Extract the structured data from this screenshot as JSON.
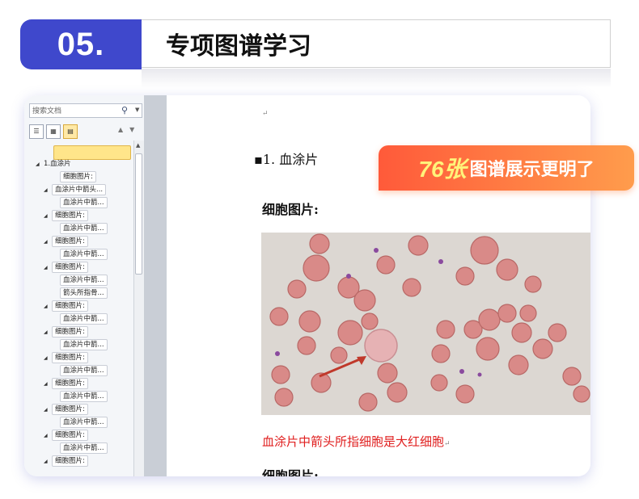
{
  "header": {
    "number": "05.",
    "title": "专项图谱学习"
  },
  "nav": {
    "search_placeholder": "搜索文档",
    "search_icon": "magnifier-icon",
    "tabs": [
      "headings-view",
      "pages-view",
      "results-view"
    ],
    "tree": [
      {
        "label": "",
        "level": 1,
        "selected": true
      },
      {
        "label": "1.血涂片",
        "level": 0,
        "expanded": true
      },
      {
        "label": "细胞图片:",
        "level": 2
      },
      {
        "label": "血涂片中箭头...",
        "level": 1,
        "expanded": true
      },
      {
        "label": "血涂片中箭...",
        "level": 2
      },
      {
        "label": "细胞图片:",
        "level": 1,
        "expanded": true
      },
      {
        "label": "血涂片中箭...",
        "level": 2
      },
      {
        "label": "细胞图片:",
        "level": 1,
        "expanded": true
      },
      {
        "label": "血涂片中箭...",
        "level": 2
      },
      {
        "label": "细胞图片:",
        "level": 1,
        "expanded": true
      },
      {
        "label": "血涂片中箭...",
        "level": 2
      },
      {
        "label": "箭头所指骨...",
        "level": 2
      },
      {
        "label": "细胞图片:",
        "level": 1,
        "expanded": true
      },
      {
        "label": "血涂片中箭...",
        "level": 2
      },
      {
        "label": "细胞图片:",
        "level": 1,
        "expanded": true
      },
      {
        "label": "血涂片中箭...",
        "level": 2
      },
      {
        "label": "细胞图片:",
        "level": 1,
        "expanded": true
      },
      {
        "label": "血涂片中箭...",
        "level": 2
      },
      {
        "label": "细胞图片:",
        "level": 1,
        "expanded": true
      },
      {
        "label": "血涂片中箭...",
        "level": 2
      },
      {
        "label": "细胞图片:",
        "level": 1,
        "expanded": true
      },
      {
        "label": "血涂片中箭...",
        "level": 2
      },
      {
        "label": "细胞图片:",
        "level": 1,
        "expanded": true
      },
      {
        "label": "血涂片中箭...",
        "level": 2
      },
      {
        "label": "细胞图片:",
        "level": 1,
        "expanded": true
      }
    ]
  },
  "doc": {
    "paragraph_mark": "↵",
    "heading": "1. 血涂片",
    "subheading": "细胞图片:",
    "caption": "血涂片中箭头所指细胞是大红细胞",
    "subheading2": "细胞图片:"
  },
  "badge": {
    "number": "76张",
    "text": "图谱展示更明了"
  },
  "colors": {
    "accent": "#3f48cc",
    "badge_start": "#ff5a3a",
    "badge_end": "#ff9c4c",
    "caption": "#e02020"
  }
}
